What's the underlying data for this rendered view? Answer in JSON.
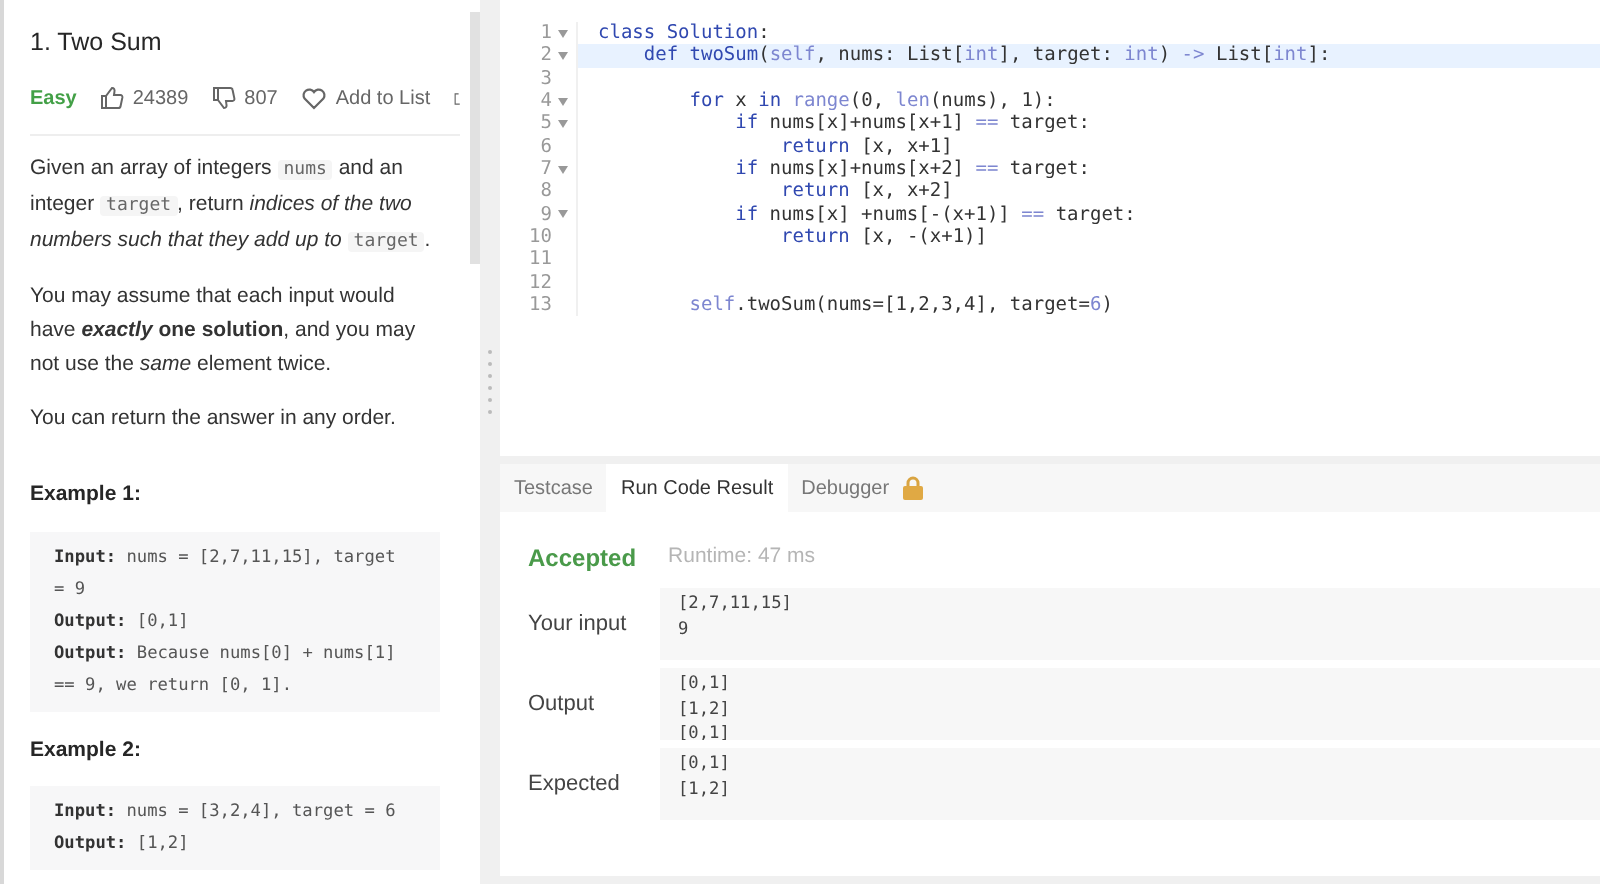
{
  "problem": {
    "title": "1. Two Sum",
    "difficulty": "Easy",
    "likes": "24389",
    "dislikes": "807",
    "add_to_list": "Add to List",
    "paragraphs": [
      [
        {
          "kind": "plain",
          "text": "Given an array of integers "
        },
        {
          "kind": "code",
          "text": "nums"
        },
        {
          "kind": "plain",
          "text": " and an integer "
        },
        {
          "kind": "code",
          "text": "target"
        },
        {
          "kind": "plain",
          "text": ", return "
        },
        {
          "kind": "italic",
          "text": "indices of the two numbers such that they add up to "
        },
        {
          "kind": "code",
          "text": "target"
        },
        {
          "kind": "plain",
          "text": "."
        }
      ],
      [
        {
          "kind": "plain",
          "text": "You may assume that each input would have "
        },
        {
          "kind": "bold_italic",
          "text": "exactly"
        },
        {
          "kind": "bold",
          "text": " one solution"
        },
        {
          "kind": "plain",
          "text": ", and you may not use the "
        },
        {
          "kind": "italic",
          "text": "same"
        },
        {
          "kind": "plain",
          "text": " element twice."
        }
      ],
      [
        {
          "kind": "plain",
          "text": "You can return the answer in any order."
        }
      ]
    ],
    "examples": [
      {
        "heading": "Example 1:",
        "lines": [
          {
            "label": "Input:",
            "text": "nums = [2,7,11,15], target = 9"
          },
          {
            "label": "Output:",
            "text": "[0,1]"
          },
          {
            "label": "Output:",
            "text": "Because nums[0] + nums[1] == 9, we return [0, 1]."
          }
        ]
      },
      {
        "heading": "Example 2:",
        "lines": [
          {
            "label": "Input:",
            "text": "nums = [3,2,4], target = 6"
          },
          {
            "label": "Output:",
            "text": "[1,2]"
          }
        ]
      }
    ]
  },
  "editor": {
    "lines": [
      {
        "number": "1",
        "foldable": true,
        "highlighted": false,
        "tokens": [
          {
            "kind": "keyword",
            "text": "class "
          },
          {
            "kind": "keyword",
            "text": "Solution"
          },
          {
            "kind": "plain",
            "text": ":"
          }
        ]
      },
      {
        "number": "2",
        "foldable": true,
        "highlighted": true,
        "tokens": [
          {
            "kind": "keyword",
            "text": "    def "
          },
          {
            "kind": "keyword",
            "text": "twoSum"
          },
          {
            "kind": "plain",
            "text": "("
          },
          {
            "kind": "builtin",
            "text": "self"
          },
          {
            "kind": "plain",
            "text": ", nums: List["
          },
          {
            "kind": "builtin",
            "text": "int"
          },
          {
            "kind": "plain",
            "text": "], target: "
          },
          {
            "kind": "builtin",
            "text": "int"
          },
          {
            "kind": "plain",
            "text": ") "
          },
          {
            "kind": "builtin",
            "text": "->"
          },
          {
            "kind": "plain",
            "text": " List["
          },
          {
            "kind": "builtin",
            "text": "int"
          },
          {
            "kind": "plain",
            "text": "]:"
          }
        ]
      },
      {
        "number": "3",
        "foldable": false,
        "highlighted": false
      },
      {
        "number": "4",
        "foldable": true,
        "highlighted": false,
        "tokens": [
          {
            "kind": "keyword",
            "text": "        for"
          },
          {
            "kind": "plain",
            "text": " x "
          },
          {
            "kind": "keyword",
            "text": "in "
          },
          {
            "kind": "builtin",
            "text": "range"
          },
          {
            "kind": "plain",
            "text": "(0, "
          },
          {
            "kind": "builtin",
            "text": "len"
          },
          {
            "kind": "plain",
            "text": "(nums), 1):"
          }
        ]
      },
      {
        "number": "5",
        "foldable": true,
        "highlighted": false,
        "tokens": [
          {
            "kind": "keyword",
            "text": "            if"
          },
          {
            "kind": "plain",
            "text": " nums[x]+nums[x+1] "
          },
          {
            "kind": "builtin",
            "text": "=="
          },
          {
            "kind": "plain",
            "text": " target:"
          }
        ]
      },
      {
        "number": "6",
        "foldable": false,
        "highlighted": false,
        "tokens": [
          {
            "kind": "keyword",
            "text": "                return"
          },
          {
            "kind": "plain",
            "text": " [x, x+1]"
          }
        ]
      },
      {
        "number": "7",
        "foldable": true,
        "highlighted": false,
        "tokens": [
          {
            "kind": "keyword",
            "text": "            if"
          },
          {
            "kind": "plain",
            "text": " nums[x]+nums[x+2] "
          },
          {
            "kind": "builtin",
            "text": "=="
          },
          {
            "kind": "plain",
            "text": " target:"
          }
        ]
      },
      {
        "number": "8",
        "foldable": false,
        "highlighted": false,
        "tokens": [
          {
            "kind": "keyword",
            "text": "                return"
          },
          {
            "kind": "plain",
            "text": " [x, x+2]"
          }
        ]
      },
      {
        "number": "9",
        "foldable": true,
        "highlighted": false,
        "tokens": [
          {
            "kind": "keyword",
            "text": "            if"
          },
          {
            "kind": "plain",
            "text": " nums[x] +nums[-(x+1)] "
          },
          {
            "kind": "builtin",
            "text": "=="
          },
          {
            "kind": "plain",
            "text": " target:"
          }
        ]
      },
      {
        "number": "10",
        "foldable": false,
        "highlighted": false,
        "tokens": [
          {
            "kind": "keyword",
            "text": "                return"
          },
          {
            "kind": "plain",
            "text": " [x, -(x+1)]"
          }
        ]
      },
      {
        "number": "11",
        "foldable": false,
        "highlighted": false
      },
      {
        "number": "12",
        "foldable": false,
        "highlighted": false
      },
      {
        "number": "13",
        "foldable": false,
        "highlighted": false,
        "tokens": [
          {
            "kind": "builtin",
            "text": "        self"
          },
          {
            "kind": "plain",
            "text": ".twoSum(nums=[1,2,3,4], target="
          },
          {
            "kind": "builtin",
            "text": "6"
          },
          {
            "kind": "plain",
            "text": ")"
          }
        ]
      }
    ]
  },
  "console": {
    "tabs": [
      {
        "label": "Testcase",
        "selected": false,
        "locked": false
      },
      {
        "label": "Run Code Result",
        "selected": true,
        "locked": false
      },
      {
        "label": "Debugger",
        "selected": false,
        "locked": true
      }
    ],
    "status": "Accepted",
    "runtime": "Runtime: 47 ms",
    "results": [
      {
        "label": "Your input",
        "lines": [
          "[2,7,11,15]",
          "9"
        ]
      },
      {
        "label": "Output",
        "lines": [
          "[0,1]",
          "[1,2]",
          "[0,1]"
        ]
      },
      {
        "label": "Expected",
        "lines": [
          "[0,1]",
          "[1,2]"
        ]
      }
    ]
  }
}
